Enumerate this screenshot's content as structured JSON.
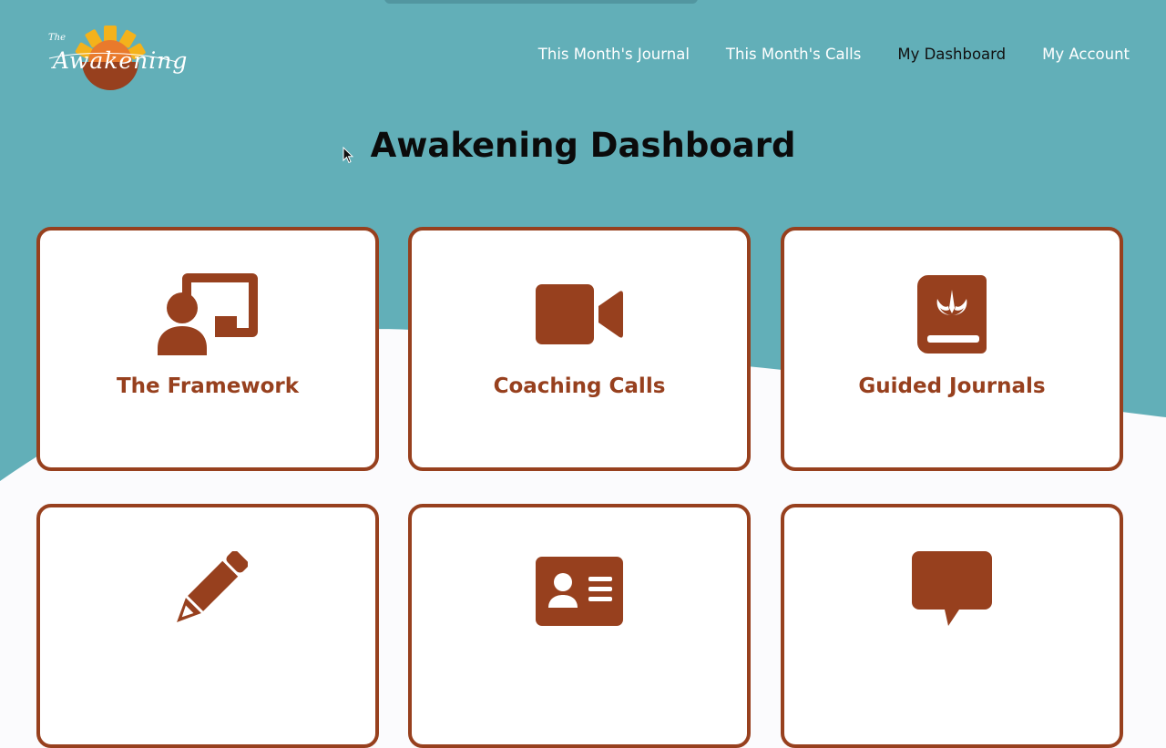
{
  "colors": {
    "teal": "#62afb8",
    "accent": "#97401e",
    "sun_yellow": "#f4b21b",
    "sun_orange": "#e97a2c",
    "background": "#fbfbfd"
  },
  "logo": {
    "the": "The",
    "name": "Awakening",
    "icon": "sunrise-logo"
  },
  "nav": {
    "items": [
      {
        "label": "This Month's Journal",
        "active": false
      },
      {
        "label": "This Month's Calls",
        "active": false
      },
      {
        "label": "My Dashboard",
        "active": true
      },
      {
        "label": "My Account",
        "active": false
      }
    ]
  },
  "page": {
    "title": "Awakening Dashboard"
  },
  "cards": [
    {
      "label": "The Framework",
      "icon": "teacher-board-icon"
    },
    {
      "label": "Coaching Calls",
      "icon": "video-camera-icon"
    },
    {
      "label": "Guided Journals",
      "icon": "journal-book-icon"
    },
    {
      "label": "",
      "icon": "pencil-icon"
    },
    {
      "label": "",
      "icon": "id-card-icon"
    },
    {
      "label": "",
      "icon": "speech-bubble-icon"
    }
  ]
}
